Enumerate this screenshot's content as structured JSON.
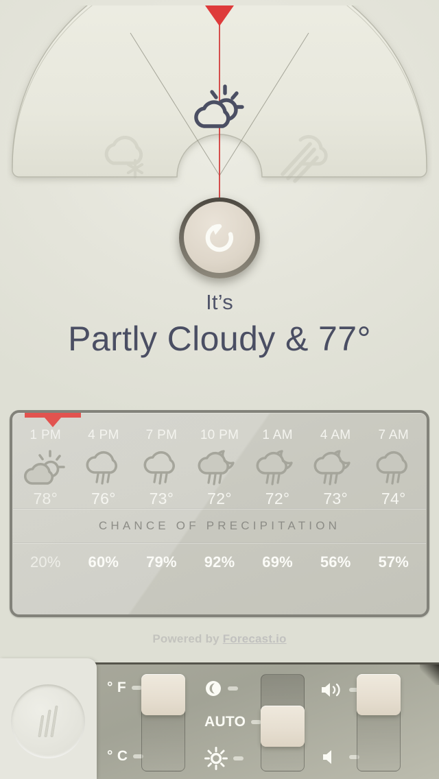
{
  "app": {
    "accent_red": "#de3b3b",
    "panel_border": "#82827a",
    "text_navy": "#4a4e63",
    "background": "#e6e6dd"
  },
  "dial": {
    "needle_icon": "partly-cloudy-day-icon",
    "left_icon": "snow-cloud-icon",
    "right_icon": "wind-cloud-icon",
    "refresh_icon": "refresh-icon"
  },
  "headline": {
    "prefix": "It’s",
    "summary": "Partly Cloudy & 77°"
  },
  "forecast": {
    "columns": [
      {
        "time": "1 PM",
        "icon": "partly-cloudy-day-icon",
        "temp": "78°",
        "precip": "20%"
      },
      {
        "time": "4 PM",
        "icon": "rain-icon",
        "temp": "76°",
        "precip": "60%"
      },
      {
        "time": "7 PM",
        "icon": "rain-icon",
        "temp": "73°",
        "precip": "79%"
      },
      {
        "time": "10 PM",
        "icon": "rain-night-icon",
        "temp": "72°",
        "precip": "92%"
      },
      {
        "time": "1 AM",
        "icon": "rain-night-icon",
        "temp": "72°",
        "precip": "69%"
      },
      {
        "time": "4 AM",
        "icon": "rain-night-icon",
        "temp": "73°",
        "precip": "56%"
      },
      {
        "time": "7 AM",
        "icon": "rain-icon",
        "temp": "74°",
        "precip": "57%"
      }
    ],
    "precip_title": "CHANCE OF PRECIPITATION",
    "now_column_index": 0
  },
  "footer": {
    "credit_prefix": "Powered by ",
    "credit_brand": "Forecast.io"
  },
  "controls": {
    "units_slider": {
      "top_label": "° F",
      "bottom_label": "° C",
      "position": "top",
      "selected": "° F"
    },
    "brightness_slider": {
      "top_icon": "moon-icon",
      "middle_label": "AUTO",
      "bottom_icon": "sun-icon",
      "position": "middle",
      "selected": "AUTO"
    },
    "volume_slider": {
      "top_icon": "volume-high-icon",
      "bottom_icon": "volume-low-icon",
      "position": "top",
      "selected": "volume-high-icon"
    },
    "speaker_icon": "speaker-grille-icon"
  }
}
